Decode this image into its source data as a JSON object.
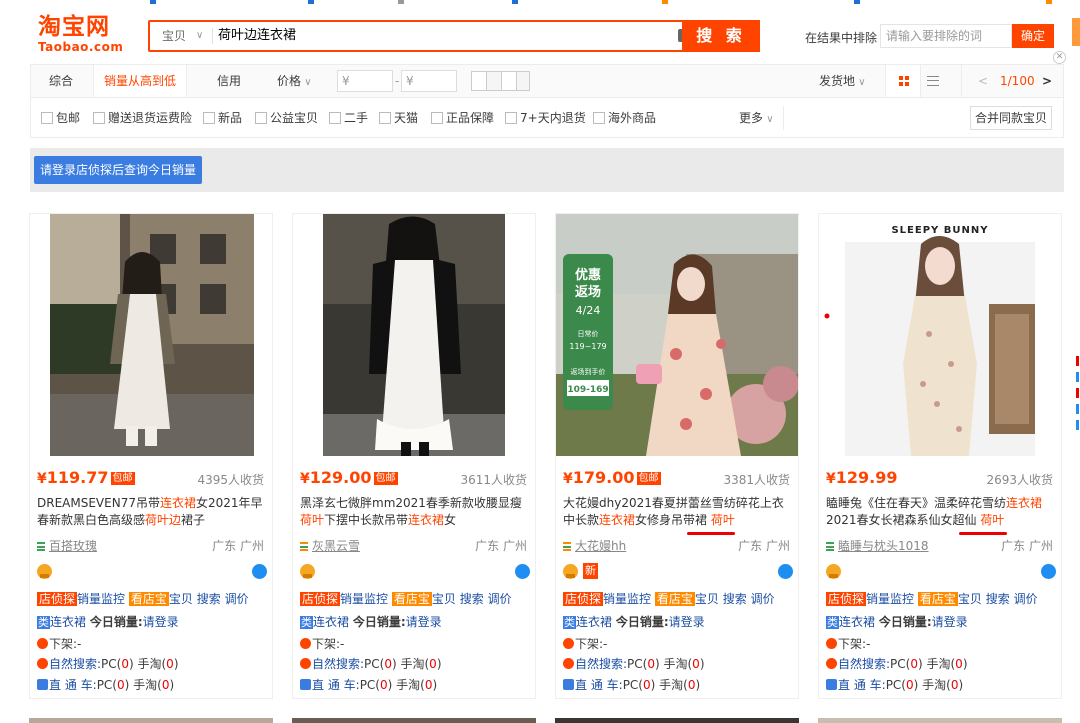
{
  "header": {
    "logo_cn": "淘宝网",
    "logo_en": "Taobao.com",
    "search_scope": "宝贝",
    "search_query": "荷叶边连衣裙",
    "search_button": "搜 索",
    "exclude_label": "在结果中排除",
    "exclude_placeholder": "请输入要排除的词",
    "exclude_button": "确定"
  },
  "sort": {
    "items": [
      "综合",
      "销量从高到低",
      "信用",
      "价格"
    ],
    "price_from": "¥",
    "price_to": "¥",
    "location": "发货地",
    "pager": "1/100"
  },
  "filters": [
    "包邮",
    "赠送退货运费险",
    "新品",
    "公益宝贝",
    "二手",
    "天猫",
    "正品保障",
    "7+天内退货",
    "海外商品"
  ],
  "filters_more": "更多",
  "merge_button": "合并同款宝贝",
  "notice_button": "请登录店侦探后查询今日销量",
  "common": {
    "tag_dzt": "店侦探",
    "sales_monitor": "销量监控",
    "tag_kdb": "看店宝",
    "item": "宝贝",
    "search": "搜索",
    "price_adj": "调价",
    "lei": "类",
    "category": "连衣裙",
    "today_sales_label": "今日销量:",
    "login": "请登录",
    "off_shelf": "下架:-",
    "natural_search": "自然搜索:",
    "pc": "PC(",
    "zero": "0",
    "close_paren": ")",
    "mobile": " 手淘(",
    "ztc": "直 通 车:",
    "xin": "新",
    "baoyou": "包邮"
  },
  "products": [
    {
      "price": "119.77",
      "baoyou": true,
      "sales": "4395人收货",
      "title_parts": [
        {
          "t": "DREAMSEVEN77吊带",
          "h": false
        },
        {
          "t": "连衣裙",
          "h": true
        },
        {
          "t": "女2021年早春新款黑白色高级感",
          "h": false
        },
        {
          "t": "荷叶边",
          "h": true
        },
        {
          "t": "裙子",
          "h": false
        }
      ],
      "shop": "百搭玫瑰",
      "location": "广东 广州"
    },
    {
      "price": "129.00",
      "baoyou": true,
      "sales": "3611人收货",
      "title_parts": [
        {
          "t": "黑泽玄七微胖mm2021春季新款收腰显瘦",
          "h": false
        },
        {
          "t": "荷叶",
          "h": true
        },
        {
          "t": "下摆中长款吊带",
          "h": false
        },
        {
          "t": "连衣裙",
          "h": true
        },
        {
          "t": "女",
          "h": false
        }
      ],
      "shop": "灰黑云雪",
      "location": "广东 广州"
    },
    {
      "price": "179.00",
      "baoyou": true,
      "sales": "3381人收货",
      "title_parts": [
        {
          "t": "大花嫚dhy2021春夏拼蕾丝雪纺碎花上衣中长款",
          "h": false
        },
        {
          "t": "连衣裙",
          "h": true
        },
        {
          "t": "女修身吊带裙 ",
          "h": false
        },
        {
          "t": "荷叶",
          "h": true
        }
      ],
      "shop": "大花嫚hh",
      "location": "广东 广州",
      "banner": {
        "line1": "优惠",
        "line2": "返场",
        "date": "4/24",
        "pre": "日常价",
        "range1": "119~179",
        "mid": "返场到手价",
        "range2": "109-169"
      }
    },
    {
      "price": "129.99",
      "baoyou": false,
      "sales": "2693人收货",
      "title_parts": [
        {
          "t": "瞌睡兔《住在春天》温柔碎花雪纺",
          "h": false
        },
        {
          "t": "连衣裙",
          "h": true
        },
        {
          "t": "2021春女长裙森系仙女超仙 ",
          "h": false
        },
        {
          "t": "荷叶",
          "h": true
        }
      ],
      "shop": "瞌睡与枕头1018",
      "location": "广东 广州",
      "brand": "SLEEPY BUNNY"
    }
  ],
  "colors": {
    "accent": "#ff4400",
    "blue": "#3b7ce0",
    "annotation": "#e00000"
  }
}
